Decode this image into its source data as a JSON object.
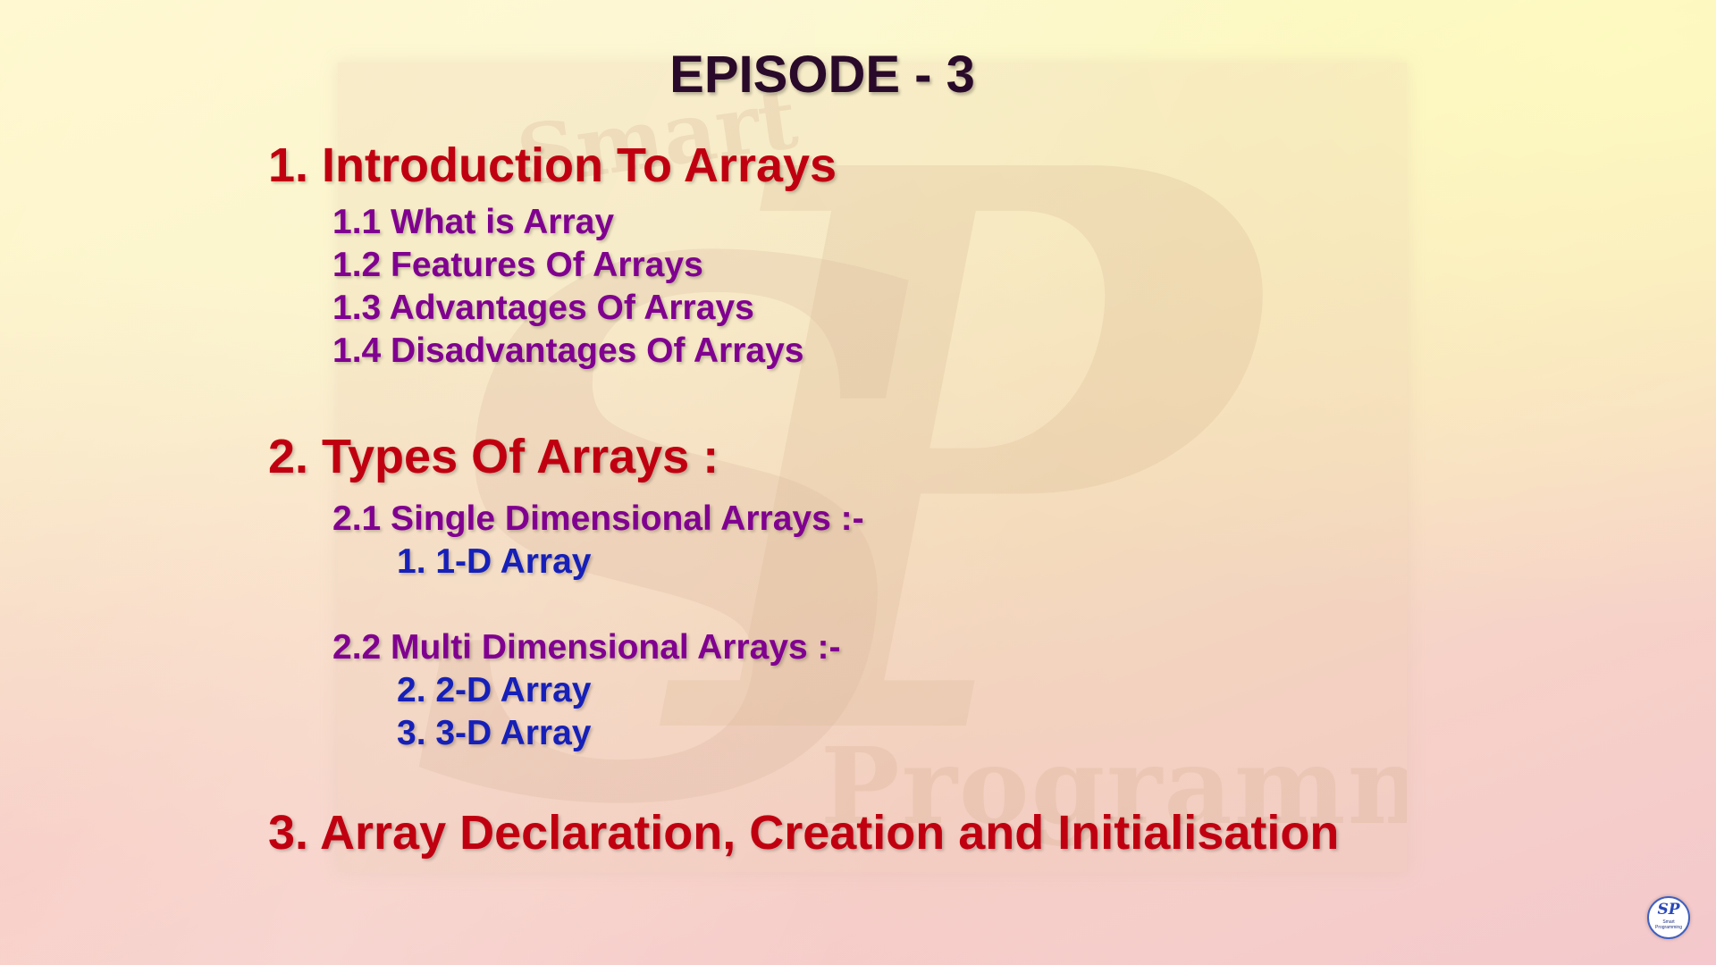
{
  "title": "EPISODE - 3",
  "sections": [
    {
      "heading": "1. Introduction To Arrays",
      "items": [
        "1.1 What is Array",
        "1.2 Features Of Arrays",
        "1.3 Advantages Of Arrays",
        "1.4 Disadvantages Of Arrays"
      ]
    },
    {
      "heading": "2. Types Of Arrays :",
      "subsections": [
        {
          "label": "2.1 Single Dimensional Arrays :-",
          "items": [
            "1. 1-D Array"
          ]
        },
        {
          "label": "2.2 Multi Dimensional Arrays :-",
          "items": [
            "2. 2-D Array",
            "3. 3-D Array"
          ]
        }
      ]
    },
    {
      "heading": "3. Array Declaration, Creation and Initialisation"
    }
  ],
  "watermark": {
    "top_text": "Smart",
    "letters": "SP",
    "bottom_text": "Programming"
  },
  "corner_logo": {
    "mark": "SP",
    "text": "Smart Programming"
  },
  "colors": {
    "title": "#2a0a2a",
    "heading": "#c00010",
    "subheading": "#800090",
    "item": "#1620b8"
  }
}
